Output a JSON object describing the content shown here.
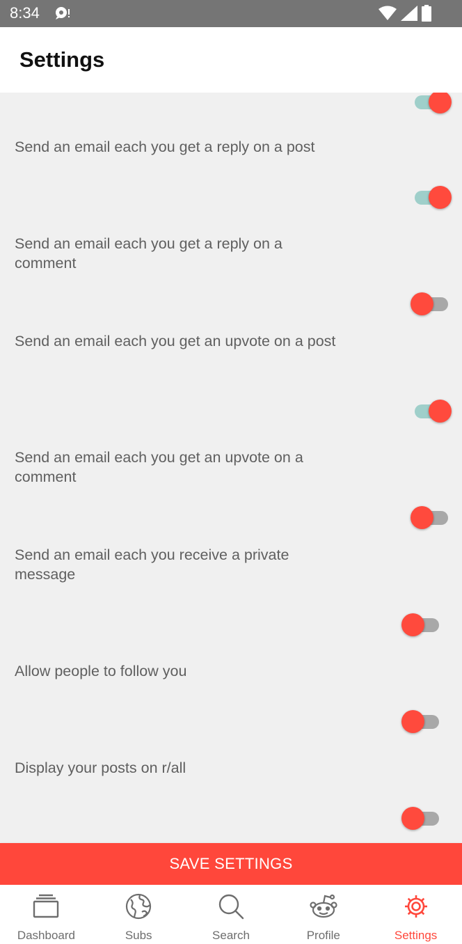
{
  "status_bar": {
    "time": "8:34",
    "icons": [
      "chat-notification-icon",
      "wifi-icon",
      "signal-icon",
      "battery-icon"
    ]
  },
  "app_bar": {
    "title": "Settings"
  },
  "settings": [
    {
      "label": "",
      "enabled": true
    },
    {
      "label": "Send an email each you get a reply on a post",
      "enabled": true
    },
    {
      "label": "Send an email each you get a reply on a comment",
      "enabled": false
    },
    {
      "label": "Send an email each you get an upvote on a post",
      "enabled": true
    },
    {
      "label": "Send an email each you get an upvote on a comment",
      "enabled": false
    },
    {
      "label": "Send an email each you receive a private message",
      "enabled": false
    },
    {
      "label": "Allow people to follow you",
      "enabled": false
    },
    {
      "label": "Display your posts on r/all",
      "enabled": false
    }
  ],
  "save_button": {
    "label": "SAVE SETTINGS"
  },
  "bottom_nav": {
    "items": [
      {
        "label": "Dashboard",
        "icon": "dashboard-icon",
        "active": false
      },
      {
        "label": "Subs",
        "icon": "globe-icon",
        "active": false
      },
      {
        "label": "Search",
        "icon": "search-icon",
        "active": false
      },
      {
        "label": "Profile",
        "icon": "reddit-alien-icon",
        "active": false
      },
      {
        "label": "Settings",
        "icon": "gear-icon",
        "active": true
      }
    ]
  },
  "colors": {
    "accent": "#ff473b",
    "switch_on_track": "#9fcfca",
    "switch_off_track": "#a8a8a8",
    "status_bar": "#757575",
    "background": "#f0f0f0"
  }
}
